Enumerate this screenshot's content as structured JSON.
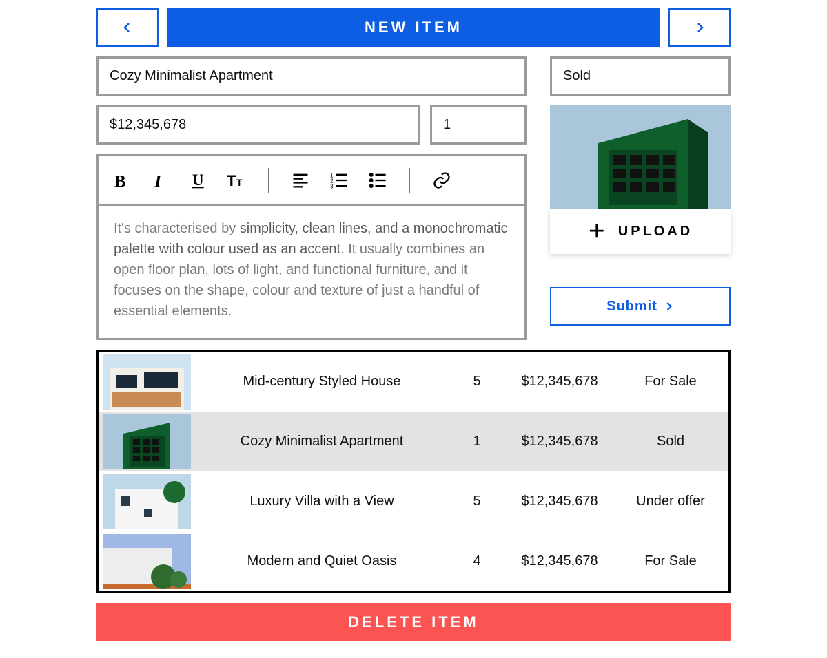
{
  "header": {
    "title": "NEW ITEM",
    "prev_icon": "chevron-left-icon",
    "next_icon": "chevron-right-icon"
  },
  "form": {
    "name": "Cozy Minimalist Apartment",
    "price": "$12,345,678",
    "qty": "1",
    "status": "Sold",
    "description_prefix": "It's characterised by ",
    "description_accent": "simplicity, clean lines, and a monochromatic palette with colour used as an accent",
    "description_suffix": ". It usually combines an open floor plan, lots of light, and functional furniture, and it focuses on the shape, colour and texture of just a handful of essential elements.",
    "upload_label": "UPLOAD",
    "submit_label": "Submit"
  },
  "toolbar": {
    "bold": "bold-icon",
    "italic": "italic-icon",
    "underline": "underline-icon",
    "text_size": "text-size-icon",
    "align": "align-left-icon",
    "ol": "ordered-list-icon",
    "ul": "unordered-list-icon",
    "link": "link-icon"
  },
  "listings": [
    {
      "title": "Mid-century Styled House",
      "qty": "5",
      "price": "$12,345,678",
      "status": "For Sale",
      "selected": false
    },
    {
      "title": "Cozy Minimalist Apartment",
      "qty": "1",
      "price": "$12,345,678",
      "status": "Sold",
      "selected": true
    },
    {
      "title": "Luxury Villa with a View",
      "qty": "5",
      "price": "$12,345,678",
      "status": "Under offer",
      "selected": false
    },
    {
      "title": "Modern and Quiet Oasis",
      "qty": "4",
      "price": "$12,345,678",
      "status": "For Sale",
      "selected": false
    }
  ],
  "footer": {
    "delete_label": "DELETE ITEM"
  }
}
